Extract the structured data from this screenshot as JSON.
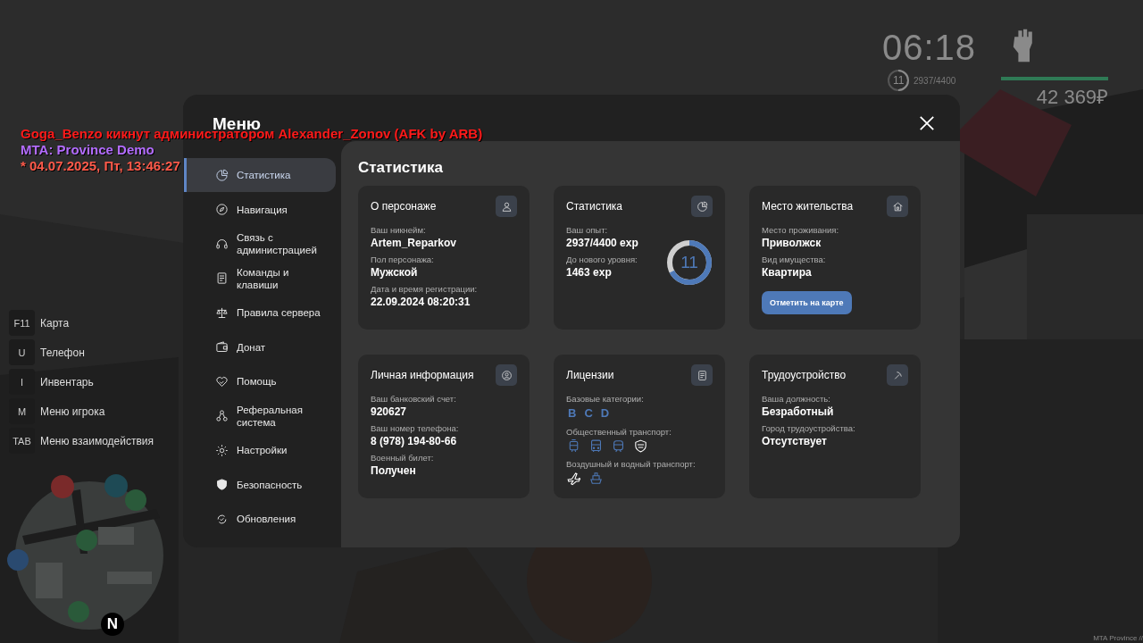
{
  "chat": [
    {
      "text": "Goga_Benzo кикнут администратором Alexander_Zonov (AFK by ARB)",
      "color": "#ff1a1a"
    },
    {
      "text": "MTA: Province Demo",
      "color": "#b36cff"
    },
    {
      "text": "* 04.07.2025, Пт, 13:46:27",
      "color": "#ff5a4a"
    }
  ],
  "hud": {
    "time": "06:18",
    "level": "11",
    "exp": "2937/4400",
    "health": {
      "level": 1
    },
    "money": "42 369₽"
  },
  "hotkeys": [
    {
      "key": "F11",
      "label": "Карта"
    },
    {
      "key": "U",
      "label": "Телефон"
    },
    {
      "key": "I",
      "label": "Инвентарь"
    },
    {
      "key": "M",
      "label": "Меню игрока"
    },
    {
      "key": "TAB",
      "label": "Меню взаимодействия"
    }
  ],
  "minimap": {
    "compass": "N"
  },
  "menu": {
    "title": "Меню",
    "sidebar": [
      {
        "label": "Статистика",
        "selected": true
      },
      {
        "label": "Навигация",
        "selected": false
      },
      {
        "label": "Связь с администрацией",
        "selected": false
      },
      {
        "label": "Команды и клавиши",
        "selected": false
      },
      {
        "label": "Правила сервера",
        "selected": false
      },
      {
        "label": "Донат",
        "selected": false
      },
      {
        "label": "Помощь",
        "selected": false
      },
      {
        "label": "Реферальная система",
        "selected": false
      },
      {
        "label": "Настройки",
        "selected": false
      },
      {
        "label": "Безопасность",
        "selected": false
      },
      {
        "label": "Обновления",
        "selected": false
      }
    ],
    "page_title": "Статистика",
    "cards": [
      {
        "kind": "fields",
        "title": "О персонаже",
        "fields": [
          {
            "label": "Ваш никнейм:",
            "value": "Artem_Reparkov"
          },
          {
            "label": "Пол персонажа:",
            "value": "Мужской"
          },
          {
            "label": "Дата и время регистрации:",
            "value": "22.09.2024 08:20:31"
          }
        ]
      },
      {
        "kind": "exp",
        "title": "Статистика",
        "fields": [
          {
            "label": "Ваш опыт:",
            "value": "2937/4400 exp"
          },
          {
            "label": "До нового уровня:",
            "value": "1463 exp"
          }
        ],
        "ring": {
          "text": "11",
          "level": 0.67
        }
      },
      {
        "kind": "fields",
        "title": "Место жительства",
        "fields": [
          {
            "label": "Место проживания:",
            "value": "Приволжск"
          },
          {
            "label": "Вид имущества:",
            "value": "Квартира"
          }
        ],
        "button": "Отметить на карте"
      },
      {
        "kind": "fields",
        "title": "Личная информация",
        "fields": [
          {
            "label": "Ваш банковский счет:",
            "value": "920627"
          },
          {
            "label": "Ваш номер телефона:",
            "value": "8 (978) 194-80-66"
          },
          {
            "label": "Военный билет:",
            "value": "Получен"
          }
        ]
      },
      {
        "kind": "licenses",
        "title": "Лицензии",
        "sections": [
          {
            "label": "Базовые категории:",
            "letters": [
              "B",
              "C",
              "D"
            ]
          },
          {
            "label": "Общественный транспорт:",
            "icons": [
              {
                "kind": "tram",
                "highlighted": false
              },
              {
                "kind": "bus",
                "highlighted": false
              },
              {
                "kind": "train",
                "highlighted": false
              },
              {
                "kind": "badge",
                "highlighted": true
              }
            ]
          },
          {
            "label": "Воздушный и водный транспорт:",
            "icons": [
              {
                "kind": "plane",
                "highlighted": true
              },
              {
                "kind": "boat",
                "highlighted": false
              }
            ]
          }
        ]
      },
      {
        "kind": "fields",
        "title": "Трудоустройство",
        "fields": [
          {
            "label": "Ваша должность:",
            "value": "Безработный"
          },
          {
            "label": "Город трудоустройства:",
            "value": "Отсутствует"
          }
        ]
      }
    ]
  },
  "footer_text": "MTA Province //"
}
